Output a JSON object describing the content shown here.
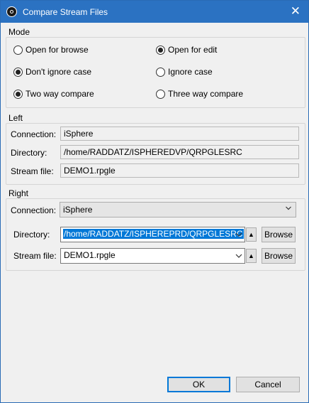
{
  "window": {
    "title": "Compare Stream Files"
  },
  "mode": {
    "label": "Mode",
    "options": [
      {
        "label": "Open for browse",
        "checked": false
      },
      {
        "label": "Open for edit",
        "checked": true
      },
      {
        "label": "Don't ignore case",
        "checked": true
      },
      {
        "label": "Ignore case",
        "checked": false
      },
      {
        "label": "Two way compare",
        "checked": true
      },
      {
        "label": "Three way compare",
        "checked": false
      }
    ]
  },
  "left": {
    "label": "Left",
    "connection_label": "Connection:",
    "connection_value": "iSphere",
    "directory_label": "Directory:",
    "directory_value": "/home/RADDATZ/ISPHEREDVP/QRPGLESRC",
    "stream_file_label": "Stream file:",
    "stream_file_value": "DEMO1.rpgle"
  },
  "right": {
    "label": "Right",
    "connection_label": "Connection:",
    "connection_value": "iSphere",
    "directory_label": "Directory:",
    "directory_value": "/home/RADDATZ/ISPHEREPRD/QRPGLESRC",
    "stream_file_label": "Stream file:",
    "stream_file_value": "DEMO1.rpgle",
    "browse_label": "Browse",
    "up_glyph": "▲"
  },
  "buttons": {
    "ok": "OK",
    "cancel": "Cancel"
  },
  "icons": {
    "app": "app-icon",
    "close": "close-icon",
    "dropdown": "chevron-down-icon",
    "up": "arrow-up-icon"
  },
  "colors": {
    "titlebar": "#2b72c2",
    "selection": "#0078d7",
    "background": "#f0f0f0"
  }
}
